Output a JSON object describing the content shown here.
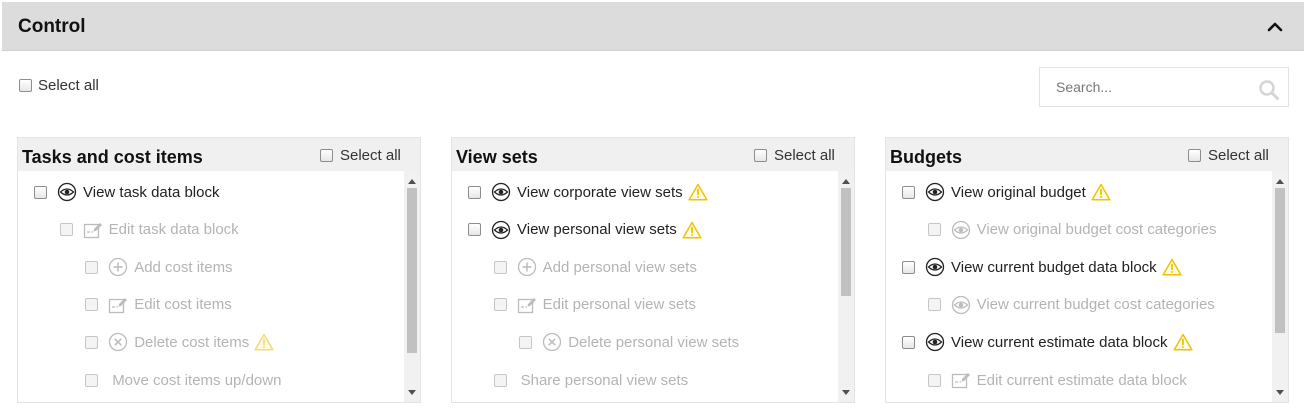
{
  "panel": {
    "title": "Control",
    "select_all_label": "Select all",
    "search_placeholder": "Search..."
  },
  "columns": [
    {
      "title": "Tasks and cost items",
      "select_all_label": "Select all",
      "items": [
        {
          "label": "View task data block",
          "icon": "eye-icon",
          "level": 0,
          "disabled": false,
          "warning": false
        },
        {
          "label": "Edit task data block",
          "icon": "edit-icon",
          "level": 1,
          "disabled": true,
          "warning": false
        },
        {
          "label": "Add cost items",
          "icon": "plus-circle-icon",
          "level": 2,
          "disabled": true,
          "warning": false
        },
        {
          "label": "Edit cost items",
          "icon": "edit-icon",
          "level": 2,
          "disabled": true,
          "warning": false
        },
        {
          "label": "Delete cost items",
          "icon": "close-circle-icon",
          "level": 2,
          "disabled": true,
          "warning": true
        },
        {
          "label": "Move cost items up/down",
          "icon": "",
          "level": 2,
          "disabled": true,
          "warning": false
        }
      ]
    },
    {
      "title": "View sets",
      "select_all_label": "Select all",
      "items": [
        {
          "label": "View corporate view sets",
          "icon": "eye-icon",
          "level": 0,
          "disabled": false,
          "warning": true
        },
        {
          "label": "View personal view sets",
          "icon": "eye-icon",
          "level": 0,
          "disabled": false,
          "warning": true
        },
        {
          "label": "Add personal view sets",
          "icon": "plus-circle-icon",
          "level": 1,
          "disabled": true,
          "warning": false
        },
        {
          "label": "Edit personal view sets",
          "icon": "edit-icon",
          "level": 1,
          "disabled": true,
          "warning": false
        },
        {
          "label": "Delete personal view sets",
          "icon": "close-circle-icon",
          "level": 2,
          "disabled": true,
          "warning": false
        },
        {
          "label": "Share personal view sets",
          "icon": "",
          "level": 1,
          "disabled": true,
          "warning": false
        }
      ]
    },
    {
      "title": "Budgets",
      "select_all_label": "Select all",
      "items": [
        {
          "label": "View original budget",
          "icon": "eye-icon",
          "level": 0,
          "disabled": false,
          "warning": true
        },
        {
          "label": "View original budget cost categories",
          "icon": "eye-icon",
          "level": 1,
          "disabled": true,
          "warning": false
        },
        {
          "label": "View current budget data block",
          "icon": "eye-icon",
          "level": 0,
          "disabled": false,
          "warning": true
        },
        {
          "label": "View current budget cost categories",
          "icon": "eye-icon",
          "level": 1,
          "disabled": true,
          "warning": false
        },
        {
          "label": "View current estimate data block",
          "icon": "eye-icon",
          "level": 0,
          "disabled": false,
          "warning": true
        },
        {
          "label": "Edit current estimate data block",
          "icon": "edit-icon",
          "level": 1,
          "disabled": true,
          "warning": false
        }
      ]
    }
  ],
  "colors": {
    "header_bg": "#dcdcdc",
    "column_header_bg": "#f0f0f0",
    "disabled_text": "#b4b4b4",
    "warning": "#f2c200"
  }
}
